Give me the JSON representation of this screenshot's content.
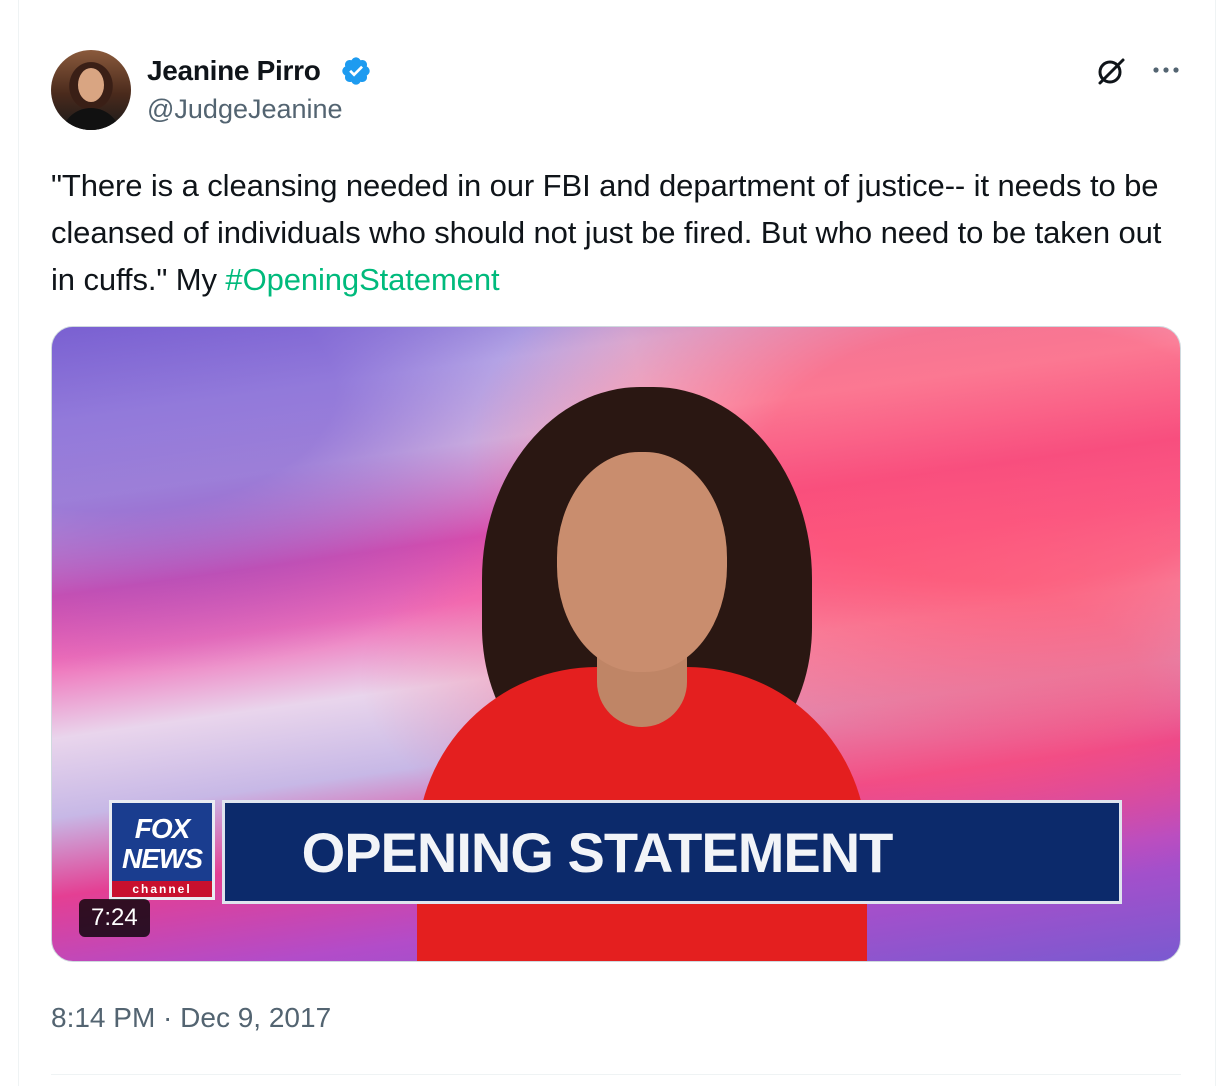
{
  "author": {
    "name": "Jeanine Pirro",
    "handle": "@JudgeJeanine",
    "verified": true
  },
  "tweet": {
    "text": "\"There is a cleansing needed in our FBI and department of justice-- it needs to be cleansed of individuals who should not just be fired. But who need to be taken out in cuffs.\" My ",
    "hashtag": "#OpeningStatement",
    "timestamp": "8:14 PM · Dec 9, 2017"
  },
  "media": {
    "logo": {
      "line1": "FOX",
      "line2": "NEWS",
      "line3": "channel"
    },
    "lower_third": "OPENING STATEMENT",
    "duration": "7:24"
  },
  "icons": {
    "grok": "grok-icon",
    "more": "more-icon",
    "verified": "verified-badge-icon"
  },
  "colors": {
    "hashtag": "#00ba7c",
    "verified": "#1d9bf0",
    "secondary_text": "#536471"
  }
}
